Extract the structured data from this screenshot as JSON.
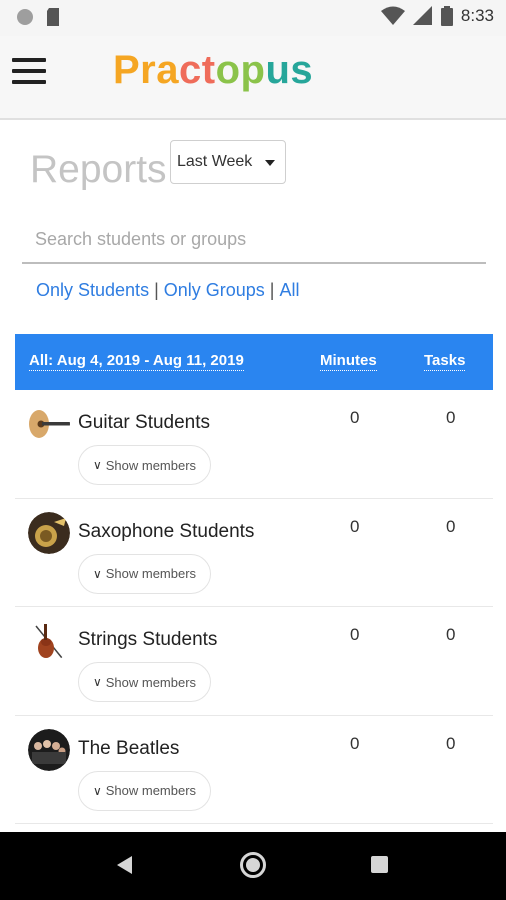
{
  "status_bar": {
    "time": "8:33",
    "icons": [
      "circle-notification-icon",
      "sd-card-icon",
      "wifi-icon",
      "signal-icon",
      "battery-icon"
    ]
  },
  "header": {
    "menu_icon": "hamburger-menu-icon",
    "brand": {
      "parts": [
        "Pra",
        "ct",
        "op",
        "us"
      ],
      "colors": [
        "#f5a623",
        "#ef6c5a",
        "#8bc34a",
        "#26a69a"
      ]
    }
  },
  "reports": {
    "title": "Reports",
    "range_select": "Last Week"
  },
  "search": {
    "placeholder": "Search students or groups",
    "value": ""
  },
  "filters": {
    "only_students": "Only Students",
    "only_groups": "Only Groups",
    "all": "All",
    "separator": "|"
  },
  "table": {
    "header": {
      "range": "All: Aug 4, 2019 - Aug 11, 2019",
      "minutes": "Minutes",
      "tasks": "Tasks"
    },
    "accent": "#2a85f0",
    "rows": [
      {
        "name": "Guitar Students",
        "minutes": "0",
        "tasks": "0",
        "show_members": "Show members",
        "icon": "guitar-icon"
      },
      {
        "name": "Saxophone Students",
        "minutes": "0",
        "tasks": "0",
        "show_members": "Show members",
        "icon": "saxophone-icon"
      },
      {
        "name": "Strings Students",
        "minutes": "0",
        "tasks": "0",
        "show_members": "Show members",
        "icon": "violin-icon"
      },
      {
        "name": "The Beatles",
        "minutes": "0",
        "tasks": "0",
        "show_members": "Show members",
        "icon": "band-photo-icon"
      }
    ]
  },
  "nav_bar": {
    "icons": [
      "back-icon",
      "home-icon",
      "recent-apps-icon"
    ]
  }
}
